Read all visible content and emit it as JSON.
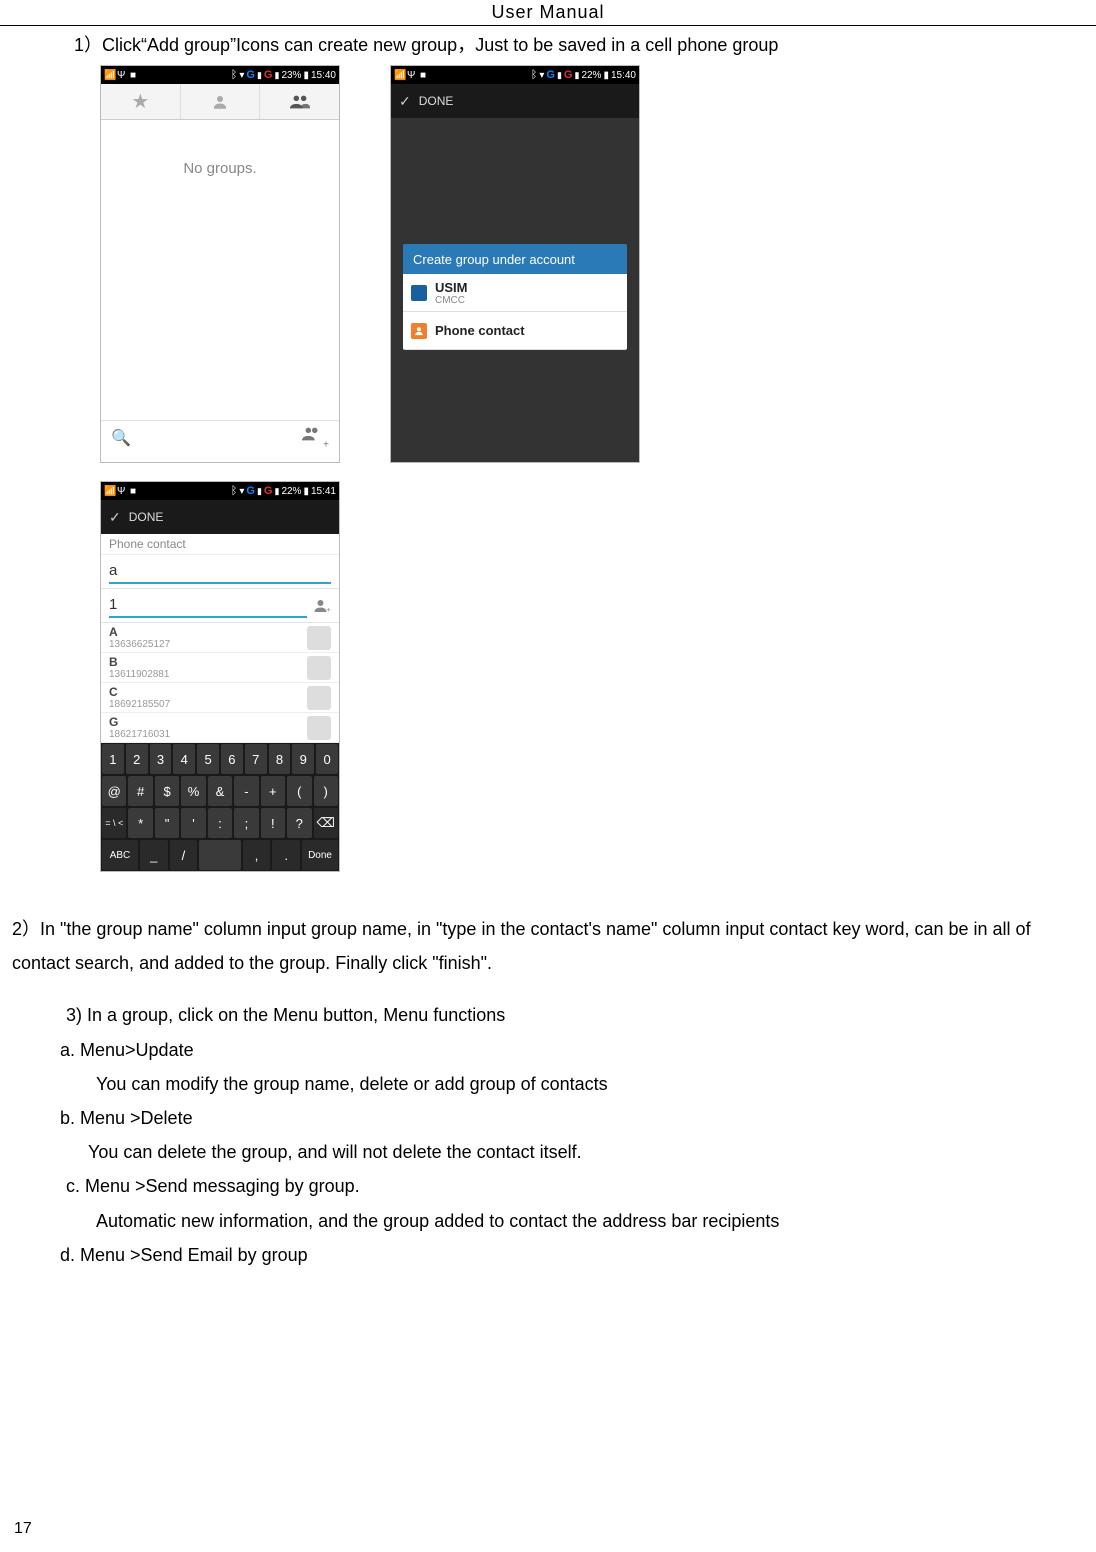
{
  "header": {
    "title": "User    Manual"
  },
  "steps": {
    "one": "1）Click“Add group”Icons can create new group，Just to be saved in a cell phone group",
    "two": "2）In \"the group name\" column input group name, in \"type in the contact's name\" column input contact key word, can be in all of contact search, and added to the group. Finally click \"finish\".",
    "three": "3) In a group, click on the Menu button,    Menu functions",
    "a": "a.    Menu>Update",
    "a_desc": "You can modify the group name, delete or add group of contacts",
    "b": "b.    Menu >Delete",
    "b_desc": "You can delete the group, and will not delete the contact itself.",
    "c": "c.    Menu >Send messaging by group.",
    "c_desc": "Automatic new information, and the group added to contact the address bar recipients",
    "d": "d.    Menu >Send Email by group"
  },
  "page_number": "17",
  "phone1": {
    "status": {
      "battery": "23%",
      "time": "15:40"
    },
    "body_text": "No groups."
  },
  "phone2": {
    "status": {
      "battery": "22%",
      "time": "15:40"
    },
    "done_label": "DONE",
    "dialog_title": "Create group under account",
    "row1": {
      "title": "USIM",
      "sub": "CMCC"
    },
    "row2": {
      "title": "Phone contact"
    }
  },
  "phone3": {
    "status": {
      "battery": "22%",
      "time": "15:41"
    },
    "done_label": "DONE",
    "section": "Phone contact",
    "input1": "a",
    "input2": "1",
    "contacts": [
      {
        "letter": "A",
        "num": "13636625127"
      },
      {
        "letter": "B",
        "num": "13611902881"
      },
      {
        "letter": "C",
        "num": "18692185507"
      },
      {
        "letter": "G",
        "num": "18621716031"
      }
    ],
    "kbd": {
      "r1": [
        "1",
        "2",
        "3",
        "4",
        "5",
        "6",
        "7",
        "8",
        "9",
        "0"
      ],
      "r2": [
        "@",
        "#",
        "$",
        "%",
        "&",
        "-",
        "+",
        "(",
        ")"
      ],
      "r3": [
        "= \\ <",
        "*",
        "\"",
        "'",
        ":",
        ";",
        "!",
        "?",
        "⌫"
      ],
      "r4": [
        "ABC",
        "_",
        "/",
        ",",
        ".",
        "Done"
      ]
    }
  }
}
